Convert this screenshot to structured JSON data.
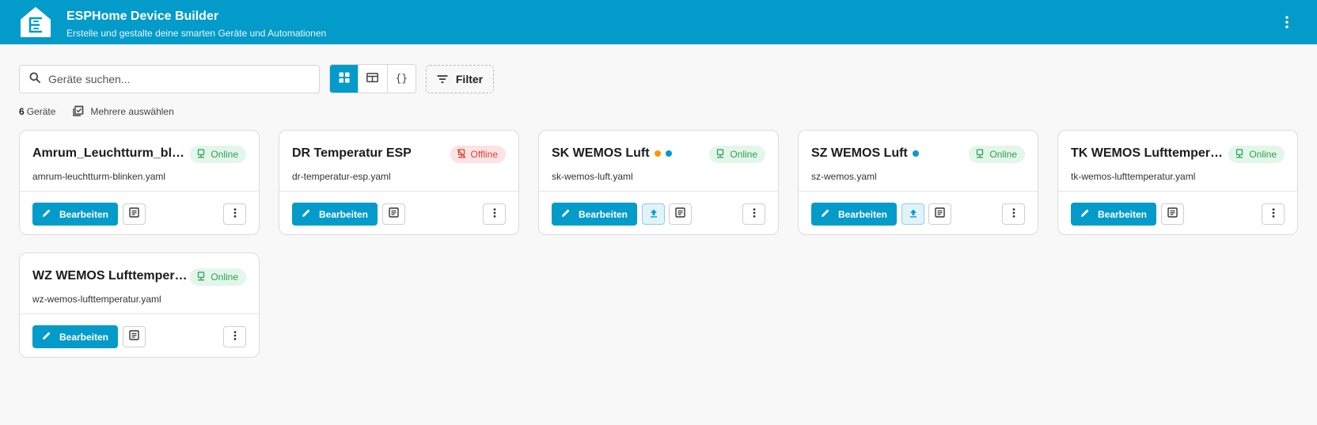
{
  "header": {
    "title": "ESPHome Device Builder",
    "subtitle": "Erstelle und gestalte deine smarten Geräte und Automationen"
  },
  "toolbar": {
    "search_placeholder": "Geräte suchen...",
    "view_json_label": "{}",
    "filter_label": "Filter"
  },
  "summary": {
    "count": "6",
    "count_label": "Geräte",
    "multi_select_label": "Mehrere auswählen"
  },
  "card_labels": {
    "edit": "Bearbeiten"
  },
  "devices": [
    {
      "name": "Amrum_Leuchtturm_blinken",
      "file": "amrum-leuchtturm-blinken.yaml",
      "status": "Online"
    },
    {
      "name": "DR Temperatur ESP",
      "file": "dr-temperatur-esp.yaml",
      "status": "Offline"
    },
    {
      "name": "SK WEMOS Luft",
      "file": "sk-wemos-luft.yaml",
      "status": "Online"
    },
    {
      "name": "SZ WEMOS Luft",
      "file": "sz-wemos.yaml",
      "status": "Online"
    },
    {
      "name": "TK WEMOS Lufttemperatur",
      "file": "tk-wemos-lufttemperatur.yaml",
      "status": "Online"
    },
    {
      "name": "WZ WEMOS Lufttemperatur",
      "file": "wz-wemos-lufttemperatur.yaml",
      "status": "Online"
    }
  ],
  "colors": {
    "primary": "#039bc9",
    "online_bg": "#e3f6ea",
    "online_text": "#2e9f55",
    "offline_bg": "#fde3e3",
    "offline_text": "#d9443c",
    "dot_orange": "#ff9800"
  },
  "icons": {
    "logo": "esphome-logo-icon",
    "header_menu": "kebab-menu-icon",
    "search": "search-icon",
    "view_grid": "grid-view-icon",
    "view_table": "table-view-icon",
    "filter": "filter-icon",
    "multi_select": "checklist-icon",
    "status": "device-status-icon",
    "edit": "pencil-icon",
    "logs": "logs-icon",
    "upload": "upload-icon",
    "more": "kebab-menu-icon"
  }
}
